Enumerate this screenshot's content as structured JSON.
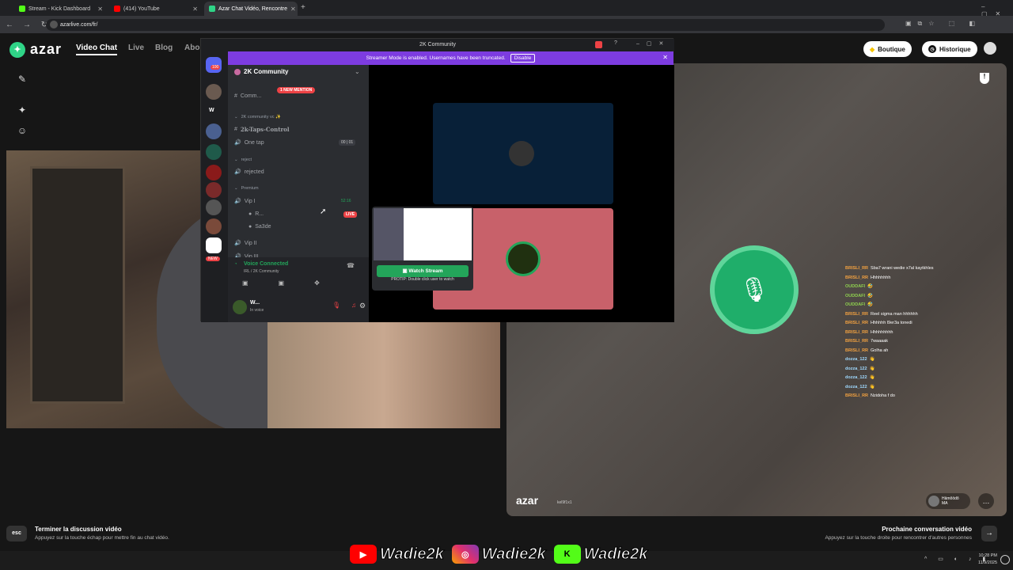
{
  "browser": {
    "tabs": [
      {
        "label": "Stream - Kick Dashboard",
        "color": "#53fc18"
      },
      {
        "label": "(414) YouTube",
        "color": "#ff0000"
      },
      {
        "label": "Azar Chat Vidéo, Rencontre",
        "color": "#2fd487"
      }
    ],
    "url": "azarlive.com/fr/"
  },
  "site": {
    "logo": "azar",
    "nav": [
      "Video Chat",
      "Live",
      "Blog",
      "Abo"
    ],
    "boutique": "Boutique",
    "historique": "Historique",
    "watermark": "azar",
    "watermark_id": "kel9f1x1",
    "partner_name": "Hāmõōdõ",
    "partner_country": "MA"
  },
  "discord": {
    "title": "2K Community",
    "streamer_banner": "Streamer Mode is enabled. Usernames have been truncated.",
    "disable": "Disable",
    "server": "2K Community",
    "new_mention": "1 NEW MENTION",
    "channels": [
      {
        "kind": "cat",
        "label": "2K community vc ✨"
      },
      {
        "kind": "text",
        "label": "2k-Taps-Control"
      },
      {
        "kind": "voice",
        "label": "One tap",
        "badge": "00 | 01"
      },
      {
        "kind": "cat",
        "label": "reject"
      },
      {
        "kind": "voice",
        "label": "rejected"
      },
      {
        "kind": "cat",
        "label": "Premium"
      },
      {
        "kind": "voice",
        "label": "Vip I",
        "badge": "52:16"
      },
      {
        "kind": "user",
        "label": "R...",
        "badge": "LIVE"
      },
      {
        "kind": "user",
        "label": "Sa3de"
      },
      {
        "kind": "voice",
        "label": "Vip II"
      },
      {
        "kind": "voice",
        "label": "Vip III"
      }
    ],
    "voice_connected": "Voice Connected",
    "voice_sub": "IRL / 2K Community",
    "user": "W...",
    "user_status": "In voice",
    "watch_stream": "Watch Stream",
    "protip": "PROTIP: Double click user to watch"
  },
  "chat": [
    {
      "user": "BRISLI_RR",
      "text": "Sba7 wrani wedie x7al kaytkhles",
      "color": "#f0a040"
    },
    {
      "user": "BRISLI_RR",
      "text": "Hhhhhhhh",
      "color": "#f0a040"
    },
    {
      "user": "OUDDAFI",
      "text": "🤣",
      "color": "#8fd14f"
    },
    {
      "user": "OUDDAFI",
      "text": "🤣",
      "color": "#8fd14f"
    },
    {
      "user": "OUDDAFI",
      "text": "🤣",
      "color": "#8fd14f"
    },
    {
      "user": "BRISLI_RR",
      "text": "Reel sigma man hhhhhh",
      "color": "#f0a040"
    },
    {
      "user": "BRISLI_RR",
      "text": "Hhhhhh l9er3a tonedi",
      "color": "#f0a040"
    },
    {
      "user": "BRISLI_RR",
      "text": "Hhhhhhhhh",
      "color": "#f0a040"
    },
    {
      "user": "BRISLI_RR",
      "text": "7waaaak",
      "color": "#f0a040"
    },
    {
      "user": "BRISLI_RR",
      "text": "Golha ah",
      "color": "#f0a040"
    },
    {
      "user": "dozza_122",
      "text": "👋",
      "color": "#9fd9ff"
    },
    {
      "user": "dozza_122",
      "text": "👋",
      "color": "#9fd9ff"
    },
    {
      "user": "dozza_122",
      "text": "👋",
      "color": "#9fd9ff"
    },
    {
      "user": "dozza_122",
      "text": "👋",
      "color": "#9fd9ff"
    },
    {
      "user": "BRISLI_RR",
      "text": "Nzidoha f do",
      "color": "#f0a040"
    }
  ],
  "bottom": {
    "esc": "esc",
    "end_title": "Terminer la discussion vidéo",
    "end_sub": "Appuyez sur la touche échap pour mettre fin au chat vidéo.",
    "next_title": "Prochaine conversation vidéo",
    "next_sub": "Appuyez sur la touche droite pour rencontrer d'autres personnes"
  },
  "overlay": {
    "handle": "Wadie2k"
  },
  "taskbar": {
    "time": "10:28 PM",
    "date": "11/9/2025"
  },
  "colors": {
    "azar_green": "#2fd487",
    "discord_purple": "#7d3ce0",
    "discord_green": "#23a55a"
  }
}
